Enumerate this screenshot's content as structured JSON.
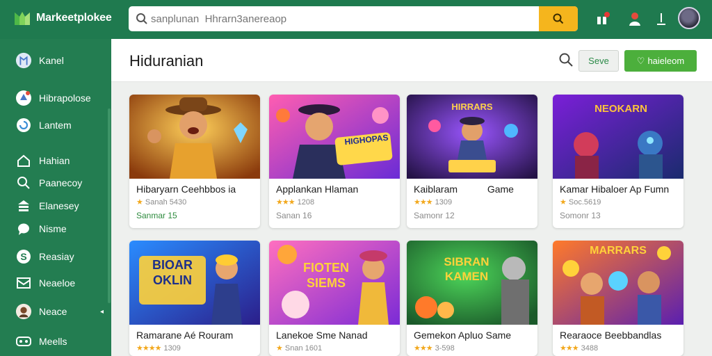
{
  "brand": {
    "name": "Markeetplokee",
    "logo_icon": "m-logo-icon"
  },
  "search": {
    "value": "",
    "placeholder": "sanplunan  Hhrarn3anereaop",
    "button_icon": "search-icon"
  },
  "topbar_icons": [
    "gift-icon",
    "user-icon",
    "download-icon",
    "user-avatar"
  ],
  "sidebar": {
    "items": [
      {
        "label": "Kanel",
        "icon": "profile-icon"
      },
      {
        "label": "Hibrapolose",
        "icon": "game-icon"
      },
      {
        "label": "Lantem",
        "icon": "refresh-icon"
      },
      {
        "label": "Hahian",
        "icon": "home-icon"
      },
      {
        "label": "Paanecoy",
        "icon": "search-icon"
      },
      {
        "label": "Elanesey",
        "icon": "library-icon"
      },
      {
        "label": "Nisme",
        "icon": "chat-icon"
      },
      {
        "label": "Reasiay",
        "icon": "dollar-icon"
      },
      {
        "label": "Neaeloe",
        "icon": "mail-icon"
      },
      {
        "label": "Neace",
        "icon": "avatar-icon",
        "caret": "◂"
      },
      {
        "label": "Meells",
        "icon": "gamepad-icon"
      }
    ]
  },
  "header": {
    "title": "Hiduranian",
    "save_label": "Seve",
    "add_label": "haieleom",
    "add_icon": "heart-icon"
  },
  "cards": [
    {
      "title": "Hibaryarn Ceehbbos ia",
      "stars": "★",
      "rating_text": "Sanah 5430",
      "meta": "Sanmar 15",
      "meta_green": true,
      "thumb_text": ""
    },
    {
      "title": "Applankan Hlaman",
      "stars": "★★★",
      "rating_text": "1208",
      "meta": "Sanan 16",
      "meta_green": false,
      "thumb_text": "HIGHOPAS"
    },
    {
      "title": "Kaiblaram           Game",
      "stars": "★★★",
      "rating_text": "1309",
      "meta": "Samonr 12",
      "meta_green": false,
      "thumb_text": "HIRRARS"
    },
    {
      "title": "Kamar Hibaloer Ap Fumn",
      "stars": "★",
      "rating_text": "Soc.5619",
      "meta": "Somonr 13",
      "meta_green": false,
      "thumb_text": "NEOKARN"
    },
    {
      "title": "Ramarane Aé Rouram",
      "stars": "★★★★",
      "rating_text": "1309",
      "meta": "",
      "meta_green": false,
      "thumb_text": "BIOAR OKLIN"
    },
    {
      "title": "Lanekoe Sme Nanad",
      "stars": "★",
      "rating_text": "Snan 1601",
      "meta": "",
      "meta_green": false,
      "thumb_text": "FIOTEN SIEMS"
    },
    {
      "title": "Gemekon Apluo Same",
      "stars": "★★★",
      "rating_text": "3-598",
      "meta": "",
      "meta_green": false,
      "thumb_text": "SIBRAN KAMEN"
    },
    {
      "title": "Rearaoce Beebbandlas",
      "stars": "★★★",
      "rating_text": "3488",
      "meta": "",
      "meta_green": false,
      "thumb_text": "MARRARS"
    }
  ],
  "colors": {
    "topbar": "#1f7a4f",
    "sidebar": "#237d51",
    "accent": "#f5b51d",
    "primary_button": "#4caf3c",
    "star": "#f2a81d"
  }
}
